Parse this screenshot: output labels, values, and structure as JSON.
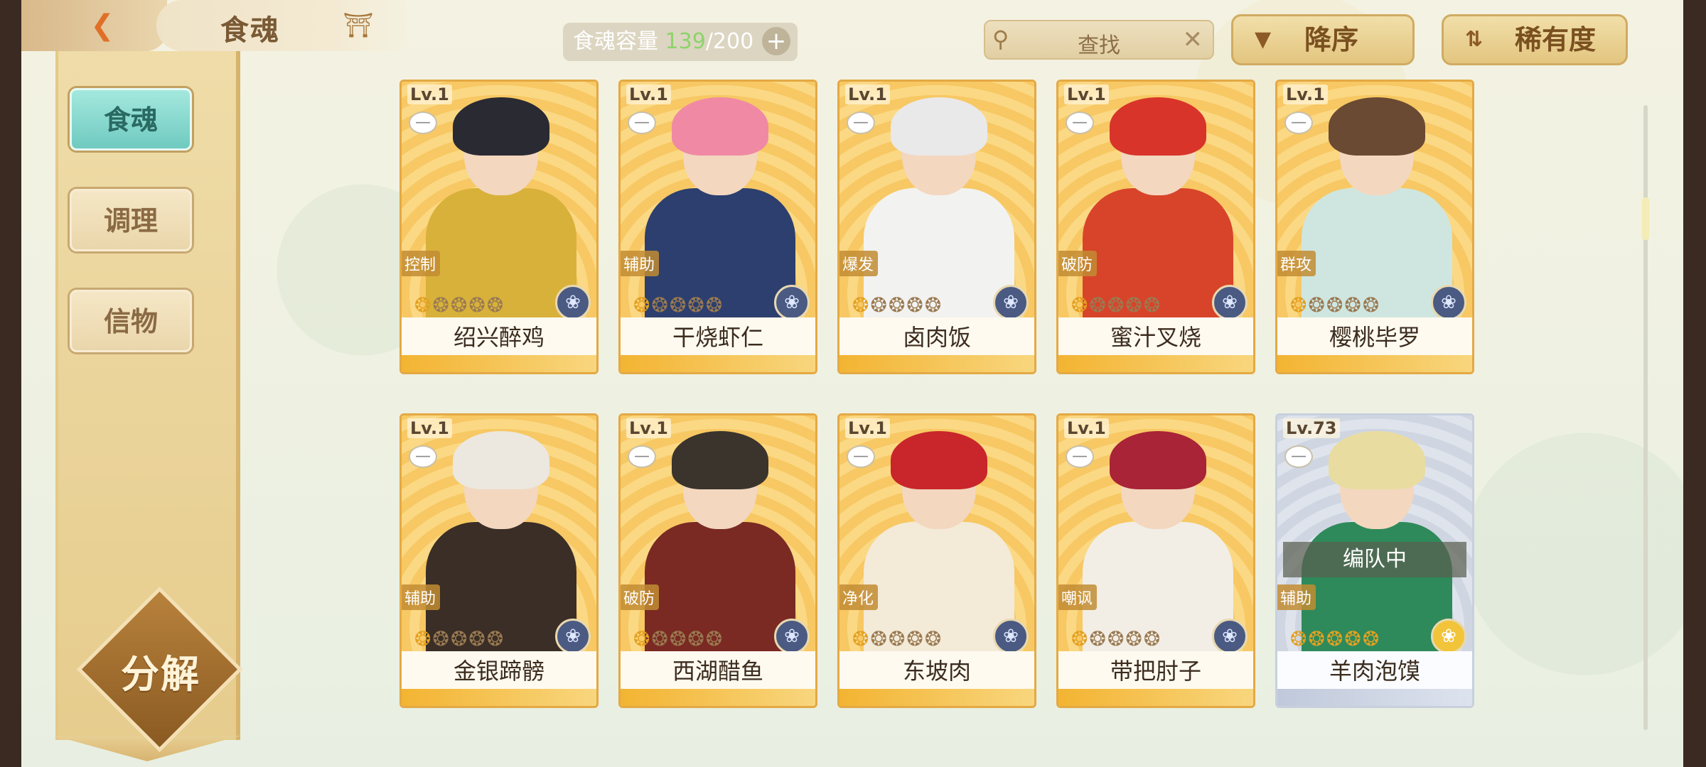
{
  "header": {
    "title": "食魂",
    "capacity_label": "食魂容量",
    "capacity_current": "139",
    "capacity_max": "/200",
    "search_placeholder": "查找",
    "sort_order_label": "降序",
    "sort_key_label": "稀有度"
  },
  "sidebar": {
    "tabs": [
      {
        "label": "食魂",
        "active": true
      },
      {
        "label": "调理",
        "active": false
      },
      {
        "label": "信物",
        "active": false
      }
    ],
    "decompose_label": "分解"
  },
  "colors": {
    "gold_frame": "#e4a944",
    "silver_frame": "#c8d0de",
    "active_tab": "#6fcac0",
    "capacity_current": "#8ed36c"
  },
  "icons": {
    "back": "back-arrow-icon",
    "home": "home-icon",
    "search": "search-icon",
    "clear": "close-icon",
    "sort_order": "triangle-down-icon",
    "sort_key": "sort-arrows-icon",
    "add": "plus-icon",
    "lock": "lock-icon",
    "element": "flower-icon"
  },
  "cards": [
    {
      "level": "Lv.1",
      "name": "绍兴醉鸡",
      "role": "控制",
      "stars_lit": 1,
      "stars_total": 5,
      "rarity": "gold",
      "hair": "#2a2a33",
      "outfit": "#d8b13a"
    },
    {
      "level": "Lv.1",
      "name": "干烧虾仁",
      "role": "辅助",
      "stars_lit": 1,
      "stars_total": 5,
      "rarity": "gold",
      "hair": "#f08aa4",
      "outfit": "#2c3f6e"
    },
    {
      "level": "Lv.1",
      "name": "卤肉饭",
      "role": "爆发",
      "stars_lit": 1,
      "stars_total": 5,
      "rarity": "gold",
      "hair": "#e9e9ea",
      "outfit": "#f2f2f0"
    },
    {
      "level": "Lv.1",
      "name": "蜜汁叉烧",
      "role": "破防",
      "stars_lit": 1,
      "stars_total": 5,
      "rarity": "gold",
      "hair": "#d8342a",
      "outfit": "#d8442a"
    },
    {
      "level": "Lv.1",
      "name": "樱桃毕罗",
      "role": "群攻",
      "stars_lit": 1,
      "stars_total": 5,
      "rarity": "gold",
      "hair": "#6a4a32",
      "outfit": "#cfe6e0"
    },
    {
      "level": "Lv.1",
      "name": "金银蹄髈",
      "role": "辅助",
      "stars_lit": 1,
      "stars_total": 5,
      "rarity": "gold",
      "hair": "#ece7df",
      "outfit": "#3a2e26"
    },
    {
      "level": "Lv.1",
      "name": "西湖醋鱼",
      "role": "破防",
      "stars_lit": 1,
      "stars_total": 5,
      "rarity": "gold",
      "hair": "#3a342c",
      "outfit": "#7a2a22"
    },
    {
      "level": "Lv.1",
      "name": "东坡肉",
      "role": "净化",
      "stars_lit": 1,
      "stars_total": 5,
      "rarity": "gold",
      "hair": "#c8262a",
      "outfit": "#f3ead8"
    },
    {
      "level": "Lv.1",
      "name": "带把肘子",
      "role": "嘲讽",
      "stars_lit": 1,
      "stars_total": 5,
      "rarity": "gold",
      "hair": "#a82436",
      "outfit": "#f2eee6"
    },
    {
      "level": "Lv.73",
      "name": "羊肉泡馍",
      "role": "辅助",
      "stars_lit": 5,
      "stars_total": 5,
      "rarity": "silver",
      "hair": "#e9dca0",
      "outfit": "#2e8a5a",
      "team_status": "编队中"
    }
  ]
}
